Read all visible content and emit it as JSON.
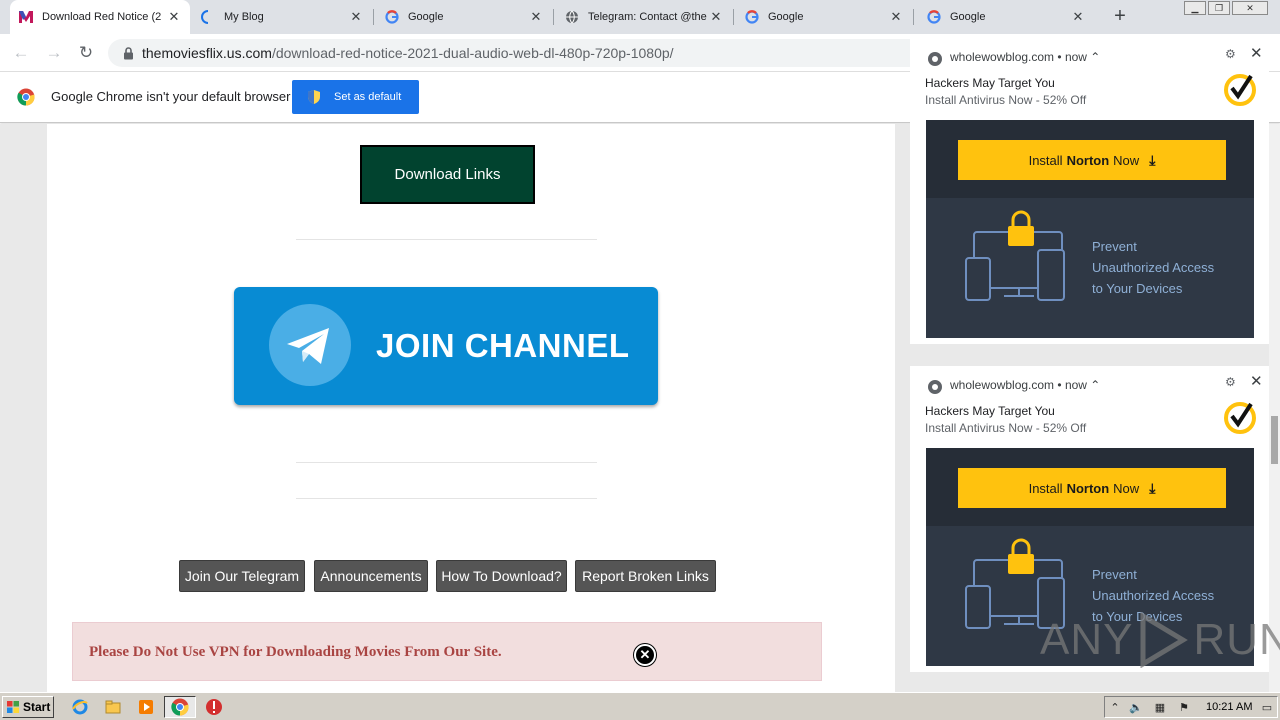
{
  "browser": {
    "tabs": [
      {
        "title": "Download Red Notice (2",
        "favicon": "movies-m-icon",
        "active": true
      },
      {
        "title": "My Blog",
        "favicon": "loading-spinner-icon",
        "active": false
      },
      {
        "title": "Google",
        "favicon": "google-g-icon",
        "active": false
      },
      {
        "title": "Telegram: Contact @the",
        "favicon": "globe-icon",
        "active": false
      },
      {
        "title": "Google",
        "favicon": "google-g-icon",
        "active": false
      },
      {
        "title": "Google",
        "favicon": "google-g-icon",
        "active": false
      }
    ],
    "new_tab_label": "+",
    "url_domain": "themoviesflix.us.com",
    "url_path": "/download-red-notice-2021-dual-audio-web-dl-480p-720p-1080p/"
  },
  "infobar": {
    "message": "Google Chrome isn't your default browser",
    "button_label": "Set as default"
  },
  "page": {
    "download_links_label": "Download Links",
    "join_channel_text": "JOIN CHANNEL",
    "buttons": [
      {
        "label": "Join Our Telegram"
      },
      {
        "label": "Announcements"
      },
      {
        "label": "How To Download?"
      },
      {
        "label": "Report Broken Links"
      }
    ],
    "vpn_notice": "Please Do Not Use VPN for Downloading Movies From Our Site.",
    "vpn_close": "✕"
  },
  "notifications": [
    {
      "source": "wholewowblog.com",
      "time": "now",
      "title": "Hackers May Target You",
      "body": "Install Antivirus Now - 52% Off",
      "ad_button_prefix": "Install",
      "ad_button_brand": "Norton",
      "ad_button_suffix": "Now",
      "ad_text_lines": [
        "Prevent",
        "Unauthorized Access",
        "to Your Devices"
      ]
    },
    {
      "source": "wholewowblog.com",
      "time": "now",
      "title": "Hackers May Target You",
      "body": "Install Antivirus Now - 52% Off",
      "ad_button_prefix": "Install",
      "ad_button_brand": "Norton",
      "ad_button_suffix": "Now",
      "ad_text_lines": [
        "Prevent",
        "Unauthorized Access",
        "to Your Devices"
      ]
    }
  ],
  "watermark": {
    "left": "ANY",
    "right": "RUN"
  },
  "taskbar": {
    "start_label": "Start",
    "clock": "10:21 AM"
  },
  "colors": {
    "download_btn_bg": "#01432f",
    "telegram_blue": "#088bd3",
    "norton_yellow": "#ffc20e",
    "ad_dark": "#262d37",
    "vpn_text": "#a94442",
    "chrome_blue": "#1a73e8"
  }
}
